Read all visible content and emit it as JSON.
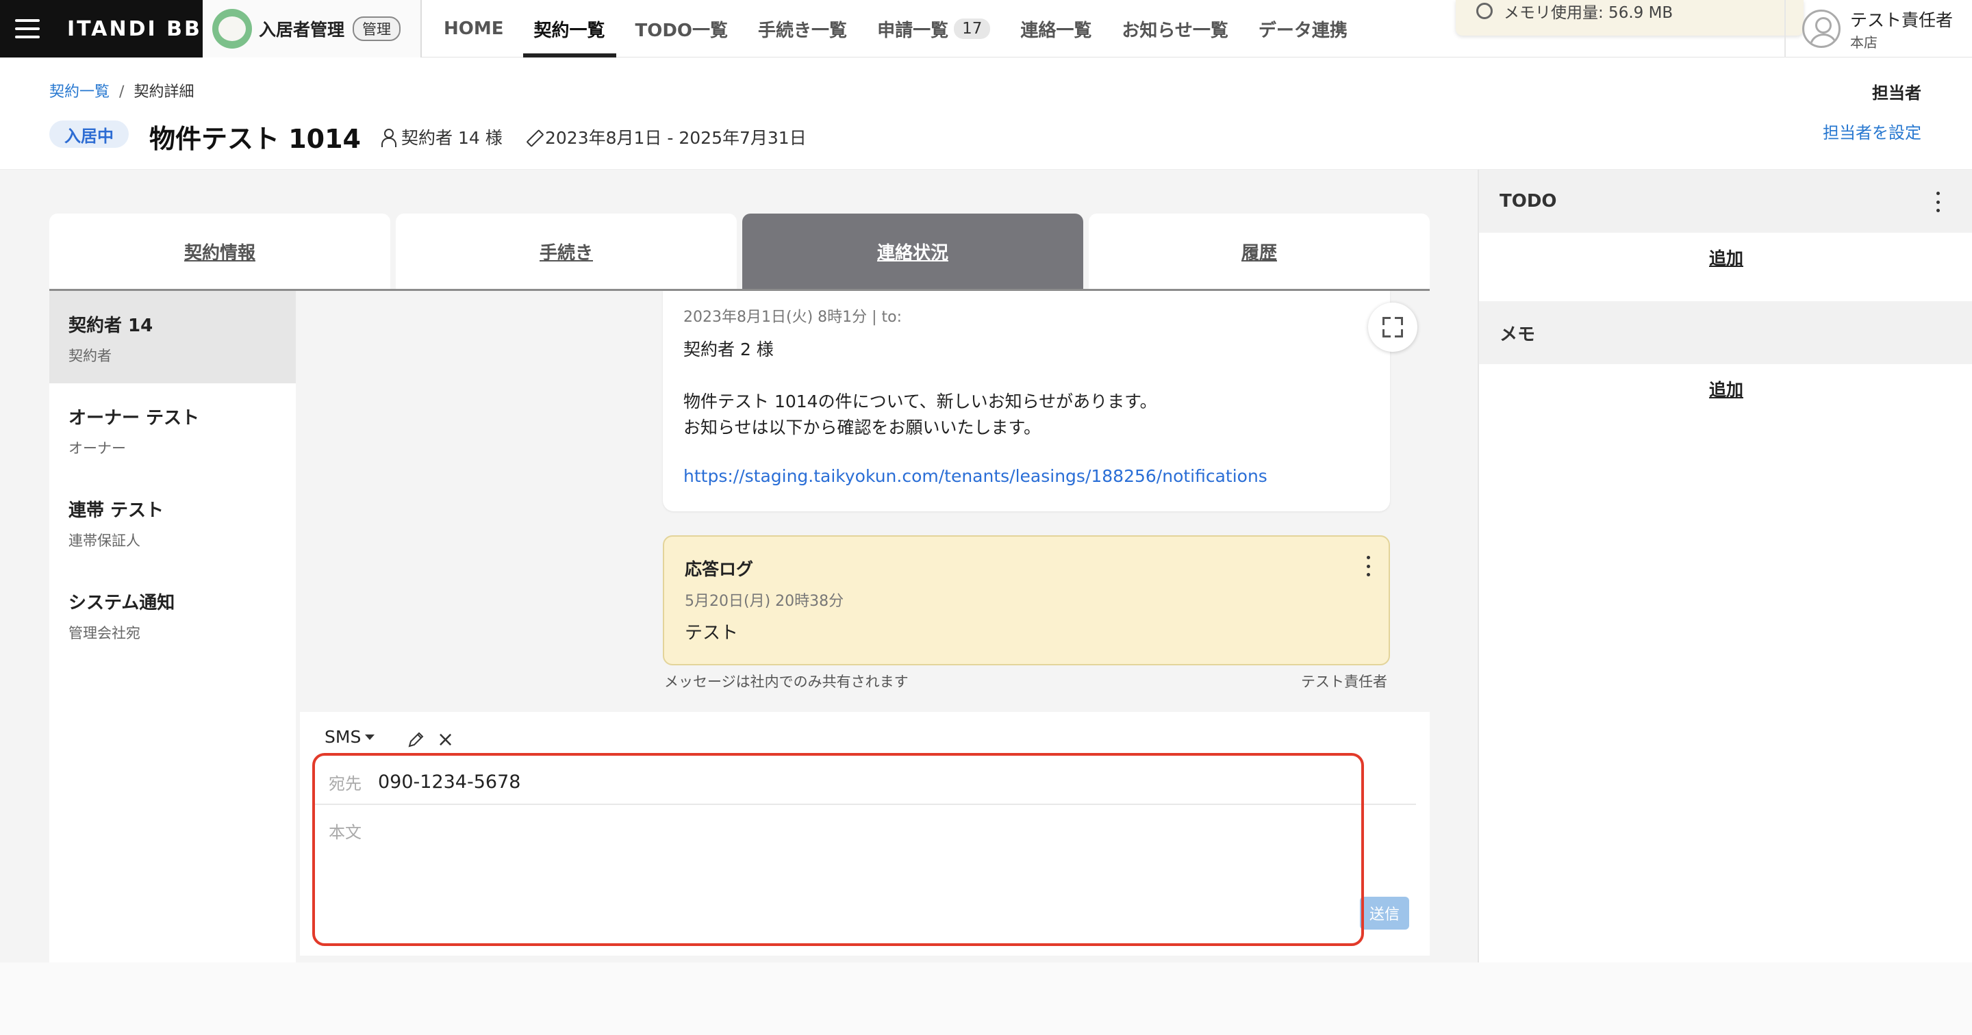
{
  "topbar": {
    "brand": "ITANDI BB",
    "section_title": "入居者管理",
    "section_badge": "管理",
    "nav": [
      {
        "label": "HOME"
      },
      {
        "label": "契約一覧"
      },
      {
        "label": "TODO一覧"
      },
      {
        "label": "手続き一覧"
      },
      {
        "label": "申請一覧",
        "count": "17"
      },
      {
        "label": "連絡一覧"
      },
      {
        "label": "お知らせ一覧"
      },
      {
        "label": "データ連携"
      }
    ],
    "active_nav": "契約一覧",
    "memory_toast": "メモリ使用量: 56.9 MB",
    "user_name": "テスト責任者",
    "user_store": "本店"
  },
  "header": {
    "breadcrumb": [
      "契約一覧",
      "契約詳細"
    ],
    "status": "入居中",
    "title": "物件テスト 1014",
    "contractor": "契約者 14 様",
    "period": "2023年8月1日 - 2025年7月31日",
    "assignee_label": "担当者",
    "assignee_link": "担当者を設定"
  },
  "tabs": [
    "契約情報",
    "手続き",
    "連絡状況",
    "履歴"
  ],
  "active_tab": "連絡状況",
  "contacts": [
    {
      "name": "契約者 14",
      "role": "契約者"
    },
    {
      "name": "オーナー テスト",
      "role": "オーナー"
    },
    {
      "name": "連帯 テスト",
      "role": "連帯保証人"
    },
    {
      "name": "システム通知",
      "role": "管理会社宛"
    }
  ],
  "message": {
    "meta": "2023年8月1日(火) 8時1分  |  to:",
    "salutation": "契約者 2 様",
    "line1": "物件テスト 1014の件について、新しいお知らせがあります。",
    "line2": "お知らせは以下から確認をお願いいたします。",
    "link": "https://staging.taikyokun.com/tenants/leasings/188256/notifications"
  },
  "log": {
    "title": "応答ログ",
    "time": "5月20日(月) 20時38分",
    "text": "テスト"
  },
  "thread_footer": {
    "share_note": "メッセージは社内でのみ共有されます",
    "sender": "テスト責任者"
  },
  "composer": {
    "channel": "SMS",
    "to_label": "宛先",
    "to_value": "090-1234-5678",
    "body_placeholder": "本文",
    "send_label": "送信"
  },
  "side": {
    "todo_title": "TODO",
    "todo_add": "追加",
    "memo_title": "メモ",
    "memo_add": "追加"
  },
  "colors": {
    "active_tab": "#76767b",
    "link": "#2878d0",
    "status_badge": "#2d6cd3",
    "log_bg": "#fbf1cf",
    "highlight": "#e23a2a",
    "send_button": "#9ec4ea"
  }
}
